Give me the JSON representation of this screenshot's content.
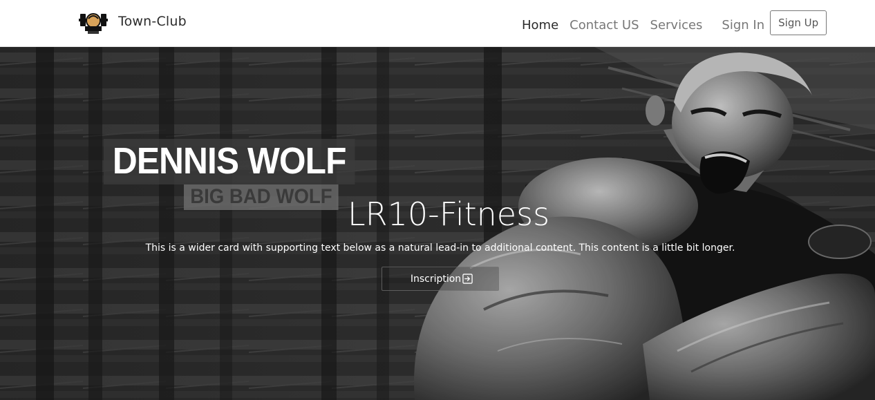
{
  "brand": {
    "name": "Town-Club",
    "logo_icon": "dumbbell-gym-logo-icon"
  },
  "nav": {
    "home": "Home",
    "contact": "Contact US",
    "services": "Services",
    "sign_in": "Sign In",
    "sign_up": "Sign Up"
  },
  "hero": {
    "poster_name": "DENNIS WOLF",
    "poster_tag": "BIG BAD WOLF",
    "title": "LR10-Fitness",
    "text": "This is a wider card with supporting text below as a natural lead-in to additional content. This content is a little bit longer.",
    "button_label": "Inscription",
    "button_icon": "arrow-right-square-icon"
  },
  "colors": {
    "nav_background": "#ffffff",
    "nav_active": "#2a2a2a",
    "nav_inactive": "#777777",
    "hero_text": "#ffffff"
  }
}
